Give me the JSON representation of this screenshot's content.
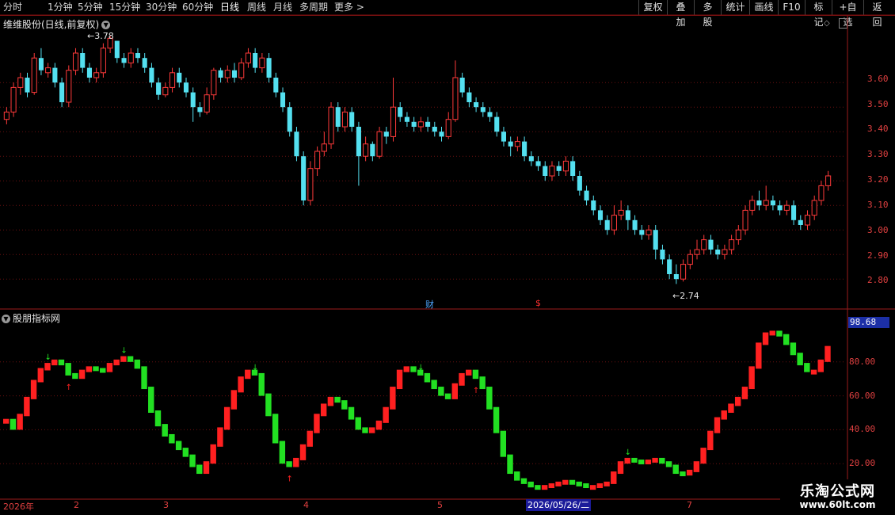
{
  "toolbar": {
    "periods": [
      "分时",
      "1分钟",
      "5分钟",
      "15分钟",
      "30分钟",
      "60分钟",
      "日线",
      "周线",
      "月线",
      "多周期",
      "更多 >"
    ],
    "active_period": "日线",
    "right_buttons": [
      "复权",
      "叠加",
      "多股",
      "统计",
      "画线",
      "F10",
      "标记",
      "+自选",
      "返回"
    ]
  },
  "main_panel": {
    "title": "维维股份(日线,前复权)",
    "high_annotation": "3.78",
    "low_annotation": "2.74",
    "y_labels": [
      "3.60",
      "3.50",
      "3.40",
      "3.30",
      "3.20",
      "3.10",
      "3.00",
      "2.90",
      "2.80"
    ],
    "markers": [
      {
        "text": "财",
        "color": "#4da6ff"
      },
      {
        "text": "$",
        "color": "#ff3030"
      }
    ]
  },
  "indicator_panel": {
    "title": "股朋指标网",
    "current_value": "98.68",
    "y_labels": [
      "80.00",
      "60.00",
      "40.00",
      "20.00"
    ]
  },
  "x_axis": {
    "labels": [
      "2026年",
      "2",
      "3",
      "4",
      "5",
      "7"
    ],
    "cursor_date": "2026/05/26/二"
  },
  "watermark": {
    "title": "乐淘公式网",
    "url": "www.60lt.com"
  },
  "colors": {
    "up": "#ff3a3a",
    "down": "#54e0f0",
    "ind_up": "#ff2020",
    "ind_down": "#22e022",
    "grid": "#6b1010"
  },
  "chart_data": [
    {
      "type": "candlestick",
      "price_range": [
        2.72,
        3.82
      ],
      "candles": [
        [
          3.45,
          3.48,
          3.43,
          3.5
        ],
        [
          3.48,
          3.58,
          3.46,
          3.6
        ],
        [
          3.58,
          3.62,
          3.55,
          3.64
        ],
        [
          3.62,
          3.56,
          3.54,
          3.64
        ],
        [
          3.56,
          3.7,
          3.55,
          3.72
        ],
        [
          3.7,
          3.65,
          3.63,
          3.74
        ],
        [
          3.64,
          3.66,
          3.62,
          3.68
        ],
        [
          3.66,
          3.6,
          3.58,
          3.68
        ],
        [
          3.6,
          3.52,
          3.5,
          3.62
        ],
        [
          3.52,
          3.65,
          3.5,
          3.67
        ],
        [
          3.65,
          3.72,
          3.63,
          3.74
        ],
        [
          3.72,
          3.66,
          3.64,
          3.74
        ],
        [
          3.66,
          3.62,
          3.6,
          3.68
        ],
        [
          3.62,
          3.64,
          3.6,
          3.66
        ],
        [
          3.64,
          3.74,
          3.62,
          3.76
        ],
        [
          3.74,
          3.78,
          3.72,
          3.79
        ],
        [
          3.77,
          3.7,
          3.68,
          3.77
        ],
        [
          3.7,
          3.68,
          3.66,
          3.72
        ],
        [
          3.68,
          3.72,
          3.66,
          3.74
        ],
        [
          3.72,
          3.7,
          3.68,
          3.74
        ],
        [
          3.7,
          3.66,
          3.64,
          3.72
        ],
        [
          3.66,
          3.6,
          3.58,
          3.68
        ],
        [
          3.6,
          3.55,
          3.53,
          3.62
        ],
        [
          3.55,
          3.58,
          3.54,
          3.6
        ],
        [
          3.58,
          3.64,
          3.56,
          3.66
        ],
        [
          3.64,
          3.6,
          3.58,
          3.66
        ],
        [
          3.6,
          3.56,
          3.54,
          3.62
        ],
        [
          3.56,
          3.5,
          3.44,
          3.58
        ],
        [
          3.5,
          3.48,
          3.46,
          3.52
        ],
        [
          3.48,
          3.55,
          3.47,
          3.58
        ],
        [
          3.55,
          3.65,
          3.53,
          3.66
        ],
        [
          3.65,
          3.62,
          3.6,
          3.66
        ],
        [
          3.62,
          3.65,
          3.6,
          3.67
        ],
        [
          3.65,
          3.62,
          3.6,
          3.68
        ],
        [
          3.62,
          3.68,
          3.61,
          3.7
        ],
        [
          3.68,
          3.72,
          3.66,
          3.74
        ],
        [
          3.72,
          3.66,
          3.64,
          3.74
        ],
        [
          3.66,
          3.7,
          3.64,
          3.72
        ],
        [
          3.7,
          3.62,
          3.6,
          3.72
        ],
        [
          3.62,
          3.56,
          3.54,
          3.64
        ],
        [
          3.56,
          3.5,
          3.48,
          3.58
        ],
        [
          3.5,
          3.4,
          3.38,
          3.52
        ],
        [
          3.4,
          3.3,
          3.28,
          3.42
        ],
        [
          3.3,
          3.12,
          3.1,
          3.32
        ],
        [
          3.12,
          3.25,
          3.1,
          3.28
        ],
        [
          3.25,
          3.32,
          3.22,
          3.34
        ],
        [
          3.32,
          3.35,
          3.3,
          3.4
        ],
        [
          3.35,
          3.5,
          3.33,
          3.52
        ],
        [
          3.5,
          3.42,
          3.4,
          3.52
        ],
        [
          3.42,
          3.48,
          3.4,
          3.5
        ],
        [
          3.48,
          3.42,
          3.4,
          3.5
        ],
        [
          3.42,
          3.3,
          3.18,
          3.44
        ],
        [
          3.3,
          3.35,
          3.28,
          3.38
        ],
        [
          3.35,
          3.3,
          3.28,
          3.36
        ],
        [
          3.3,
          3.4,
          3.29,
          3.42
        ],
        [
          3.4,
          3.38,
          3.35,
          3.42
        ],
        [
          3.38,
          3.5,
          3.36,
          3.62
        ],
        [
          3.5,
          3.46,
          3.44,
          3.52
        ],
        [
          3.46,
          3.44,
          3.42,
          3.48
        ],
        [
          3.44,
          3.42,
          3.4,
          3.46
        ],
        [
          3.42,
          3.44,
          3.4,
          3.46
        ],
        [
          3.44,
          3.42,
          3.4,
          3.46
        ],
        [
          3.42,
          3.4,
          3.38,
          3.44
        ],
        [
          3.4,
          3.38,
          3.36,
          3.42
        ],
        [
          3.38,
          3.45,
          3.37,
          3.48
        ],
        [
          3.45,
          3.62,
          3.44,
          3.69
        ],
        [
          3.62,
          3.56,
          3.54,
          3.64
        ],
        [
          3.56,
          3.52,
          3.5,
          3.58
        ],
        [
          3.52,
          3.5,
          3.48,
          3.54
        ],
        [
          3.5,
          3.48,
          3.46,
          3.52
        ],
        [
          3.48,
          3.46,
          3.44,
          3.5
        ],
        [
          3.46,
          3.4,
          3.38,
          3.48
        ],
        [
          3.4,
          3.36,
          3.34,
          3.42
        ],
        [
          3.36,
          3.34,
          3.3,
          3.38
        ],
        [
          3.34,
          3.36,
          3.32,
          3.38
        ],
        [
          3.36,
          3.3,
          3.28,
          3.38
        ],
        [
          3.3,
          3.28,
          3.26,
          3.32
        ],
        [
          3.28,
          3.26,
          3.24,
          3.3
        ],
        [
          3.26,
          3.22,
          3.2,
          3.28
        ],
        [
          3.22,
          3.26,
          3.2,
          3.28
        ],
        [
          3.26,
          3.24,
          3.22,
          3.28
        ],
        [
          3.24,
          3.28,
          3.22,
          3.3
        ],
        [
          3.28,
          3.22,
          3.2,
          3.3
        ],
        [
          3.22,
          3.16,
          3.14,
          3.24
        ],
        [
          3.16,
          3.12,
          3.1,
          3.18
        ],
        [
          3.12,
          3.08,
          3.06,
          3.14
        ],
        [
          3.08,
          3.04,
          3.02,
          3.1
        ],
        [
          3.04,
          3.0,
          2.98,
          3.06
        ],
        [
          3.0,
          3.06,
          2.98,
          3.1
        ],
        [
          3.06,
          3.08,
          3.04,
          3.12
        ],
        [
          3.08,
          3.04,
          3.0,
          3.1
        ],
        [
          3.04,
          3.0,
          2.98,
          3.06
        ],
        [
          3.0,
          2.98,
          2.96,
          3.02
        ],
        [
          2.98,
          3.0,
          2.96,
          3.02
        ],
        [
          3.0,
          2.92,
          2.88,
          3.02
        ],
        [
          2.92,
          2.88,
          2.86,
          2.94
        ],
        [
          2.88,
          2.82,
          2.8,
          2.9
        ],
        [
          2.82,
          2.8,
          2.78,
          2.86
        ],
        [
          2.8,
          2.86,
          2.79,
          2.88
        ],
        [
          2.86,
          2.9,
          2.84,
          2.92
        ],
        [
          2.9,
          2.92,
          2.88,
          2.96
        ],
        [
          2.92,
          2.96,
          2.9,
          2.98
        ],
        [
          2.96,
          2.92,
          2.9,
          2.98
        ],
        [
          2.92,
          2.9,
          2.88,
          2.94
        ],
        [
          2.9,
          2.92,
          2.88,
          2.94
        ],
        [
          2.92,
          2.96,
          2.9,
          2.98
        ],
        [
          2.96,
          3.0,
          2.94,
          3.02
        ],
        [
          3.0,
          3.08,
          2.98,
          3.1
        ],
        [
          3.08,
          3.12,
          3.06,
          3.14
        ],
        [
          3.12,
          3.1,
          3.08,
          3.16
        ],
        [
          3.1,
          3.12,
          3.08,
          3.18
        ],
        [
          3.12,
          3.1,
          3.08,
          3.14
        ],
        [
          3.1,
          3.08,
          3.06,
          3.12
        ],
        [
          3.08,
          3.1,
          3.06,
          3.12
        ],
        [
          3.1,
          3.04,
          3.02,
          3.12
        ],
        [
          3.04,
          3.02,
          3.0,
          3.06
        ],
        [
          3.02,
          3.06,
          3.0,
          3.08
        ],
        [
          3.06,
          3.12,
          3.04,
          3.14
        ],
        [
          3.12,
          3.18,
          3.1,
          3.2
        ],
        [
          3.18,
          3.22,
          3.16,
          3.24
        ]
      ]
    },
    {
      "type": "bar",
      "title": "股朋指标网",
      "ylim": [
        0,
        100
      ],
      "values": [
        45,
        40,
        48,
        58,
        68,
        75,
        78,
        80,
        78,
        72,
        70,
        74,
        76,
        75,
        74,
        78,
        80,
        82,
        80,
        76,
        64,
        50,
        42,
        36,
        32,
        28,
        24,
        18,
        14,
        20,
        30,
        40,
        52,
        62,
        70,
        74,
        72,
        60,
        48,
        32,
        20,
        18,
        22,
        30,
        38,
        48,
        54,
        58,
        56,
        52,
        46,
        40,
        38,
        40,
        44,
        52,
        64,
        74,
        76,
        74,
        72,
        68,
        64,
        60,
        58,
        66,
        72,
        74,
        70,
        64,
        52,
        38,
        24,
        14,
        10,
        8,
        6,
        5,
        6,
        7,
        8,
        9,
        8,
        7,
        6,
        6,
        7,
        8,
        14,
        20,
        22,
        21,
        20,
        21,
        22,
        20,
        18,
        14,
        13,
        15,
        20,
        28,
        38,
        46,
        50,
        54,
        58,
        64,
        76,
        90,
        96,
        97,
        95,
        90,
        84,
        78,
        74,
        74,
        80,
        88
      ],
      "signal_marks": [
        {
          "index": 6,
          "type": "down"
        },
        {
          "index": 9,
          "type": "up"
        },
        {
          "index": 17,
          "type": "down"
        },
        {
          "index": 36,
          "type": "down"
        },
        {
          "index": 41,
          "type": "up"
        },
        {
          "index": 60,
          "type": "down"
        },
        {
          "index": 68,
          "type": "up"
        },
        {
          "index": 71,
          "type": "down"
        },
        {
          "index": 90,
          "type": "down"
        },
        {
          "index": 115,
          "type": "down"
        },
        {
          "index": 121,
          "type": "up"
        }
      ]
    }
  ]
}
